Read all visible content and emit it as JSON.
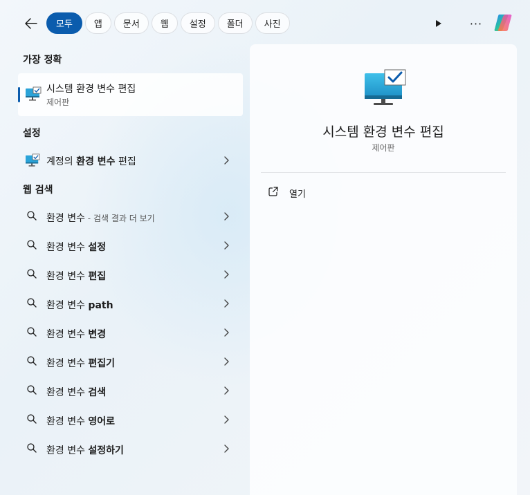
{
  "filters": {
    "back_icon": "arrow-left-icon",
    "chips": [
      "모두",
      "앱",
      "문서",
      "웹",
      "설정",
      "폴더",
      "사진"
    ],
    "active_chip": "모두"
  },
  "toolbar": {
    "play_icon": "play-icon",
    "more_label": "···",
    "copilot_icon": "copilot-logo"
  },
  "best_match": {
    "heading": "가장 정확",
    "title": "시스템 환경 변수 편집",
    "subtitle": "제어판",
    "icon": "monitor-check-icon"
  },
  "settings": {
    "heading": "설정",
    "item_prefix": "계정의 ",
    "item_bold": "환경 변수",
    "item_suffix": " 편집"
  },
  "web_search": {
    "heading": "웹 검색",
    "first_hint": " - 검색 결과 더 보기",
    "items": [
      {
        "base": "환경 변수",
        "bold": ""
      },
      {
        "base": "환경 변수 ",
        "bold": "설정"
      },
      {
        "base": "환경 변수 ",
        "bold": "편집"
      },
      {
        "base": "환경 변수 ",
        "bold": "path"
      },
      {
        "base": "환경 변수 ",
        "bold": "변경"
      },
      {
        "base": "환경 변수 ",
        "bold": "편집기"
      },
      {
        "base": "환경 변수 ",
        "bold": "검색"
      },
      {
        "base": "환경 변수 ",
        "bold": "영어로"
      },
      {
        "base": "환경 변수 ",
        "bold": "설정하기"
      }
    ]
  },
  "preview": {
    "title": "시스템 환경 변수 편집",
    "subtitle": "제어판",
    "open_label": "열기",
    "open_icon": "open-external-icon"
  },
  "colors": {
    "accent": "#0b5cad",
    "monitor": "#2aa3d8"
  }
}
